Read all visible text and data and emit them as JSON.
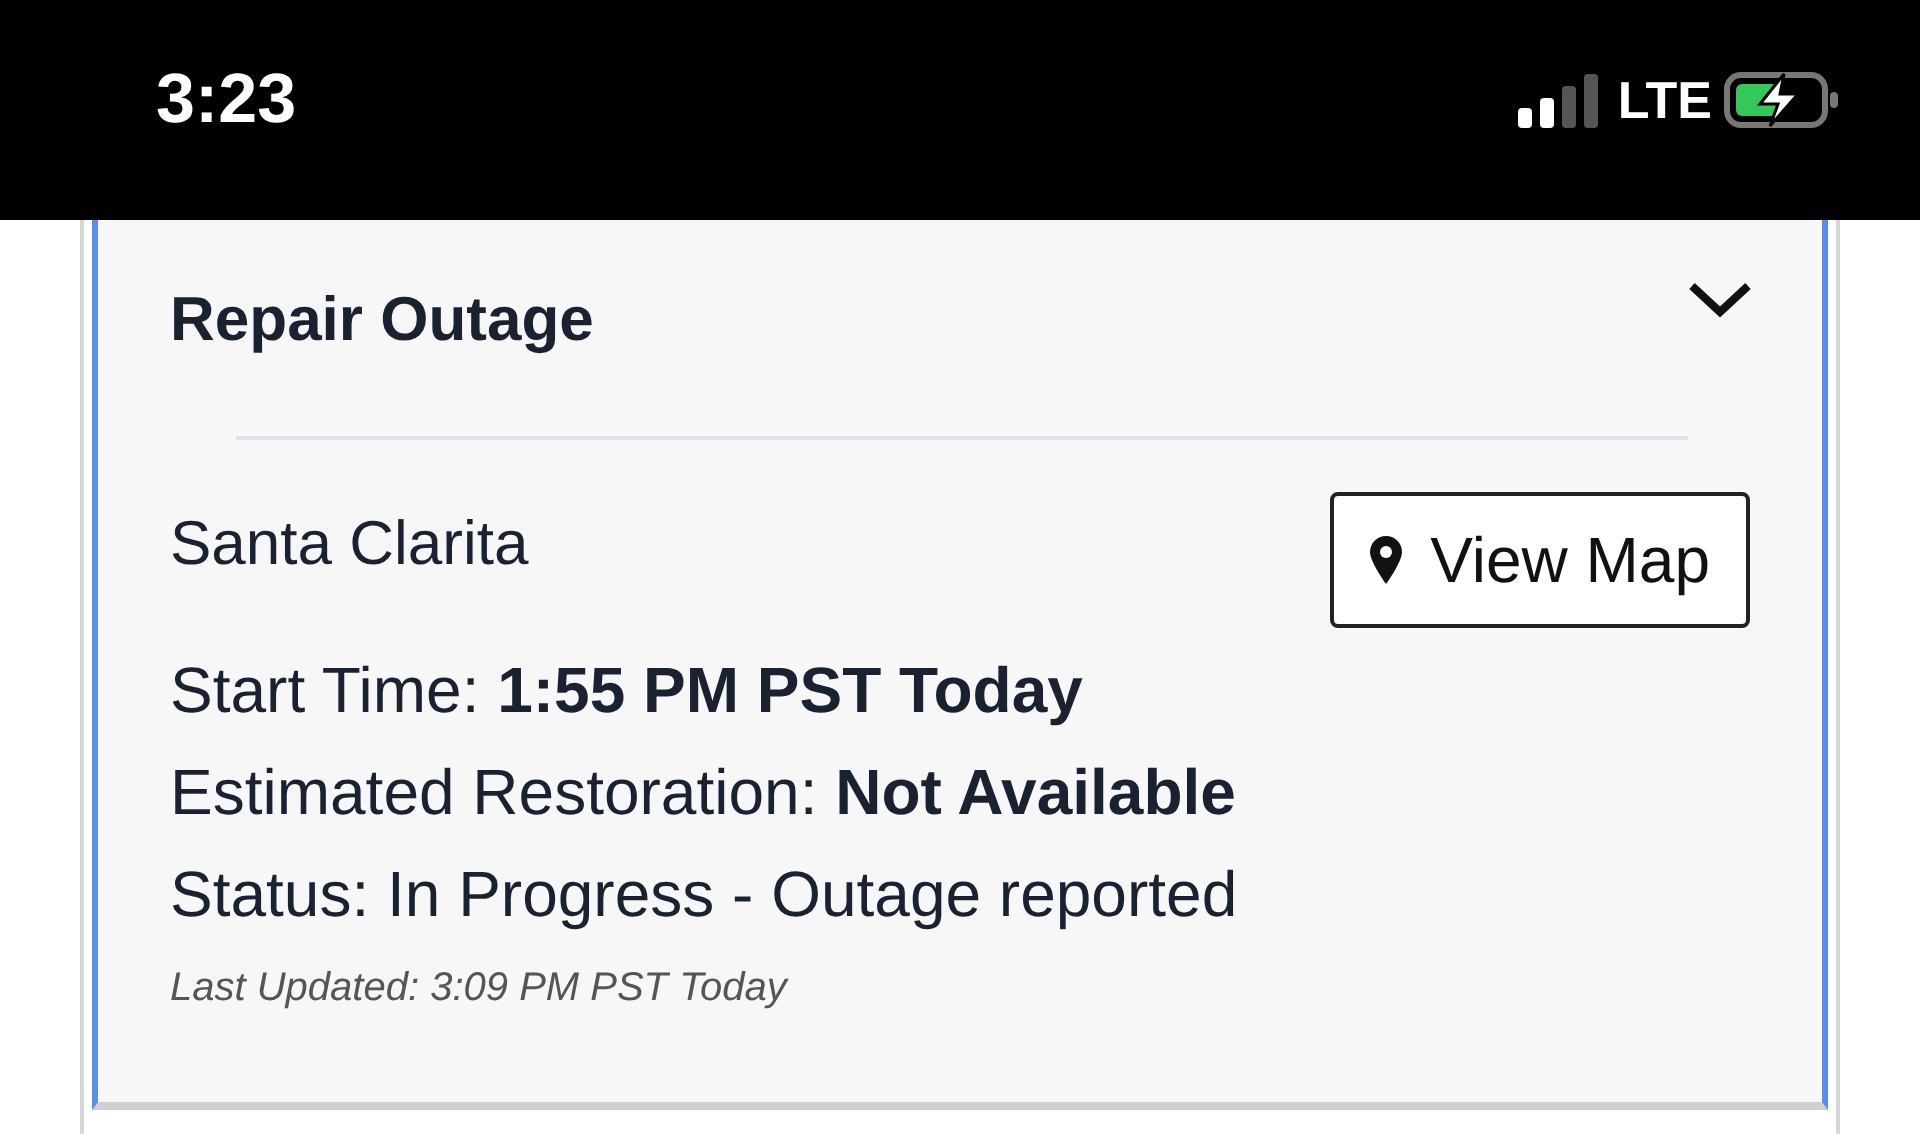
{
  "status_bar": {
    "time": "3:23",
    "network": "LTE"
  },
  "card": {
    "title": "Repair Outage",
    "expanded": true,
    "location": "Santa Clarita",
    "map_button": "View Map",
    "details": [
      "Start Time: **1:55 PM PST Today**",
      "Estimated Restoration: **Not Available**",
      "Status: In Progress - Outage reported"
    ],
    "last_updated": "Last Updated: 3:09 PM PST Today"
  }
}
